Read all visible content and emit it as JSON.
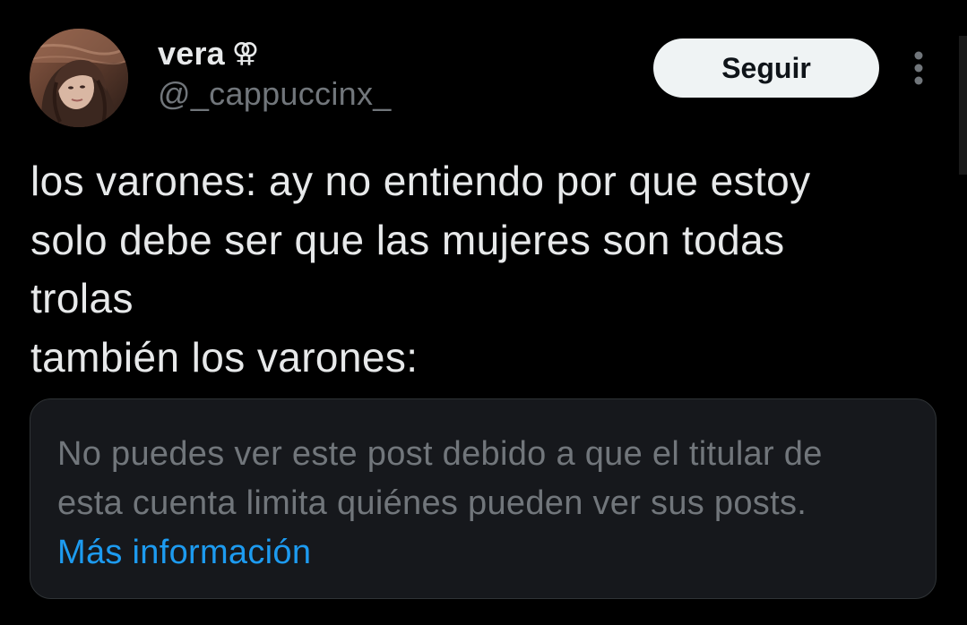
{
  "author": {
    "display_name": "vera",
    "name_emoji": "⚢",
    "handle": "@_cappuccinx_",
    "avatar_icon": "profile-photo"
  },
  "actions": {
    "follow_label": "Seguir",
    "more_icon": "vertical-ellipsis-icon"
  },
  "post": {
    "lines": [
      "los varones: ay no entiendo por que estoy",
      "solo debe ser que las mujeres son todas",
      "trolas",
      "también los varones:"
    ]
  },
  "quote": {
    "notice_lines": [
      "No puedes ver este post debido a que el titular de",
      "esta cuenta limita quiénes pueden ver sus posts."
    ],
    "link_label": "Más información"
  },
  "colors": {
    "background": "#000000",
    "text_primary": "#e7e9ea",
    "text_secondary": "#71767b",
    "link": "#1d9bf0",
    "card_background": "#16181c",
    "card_border": "#2f3336",
    "follow_button_bg": "#eff3f4",
    "follow_button_text": "#0f1419"
  }
}
